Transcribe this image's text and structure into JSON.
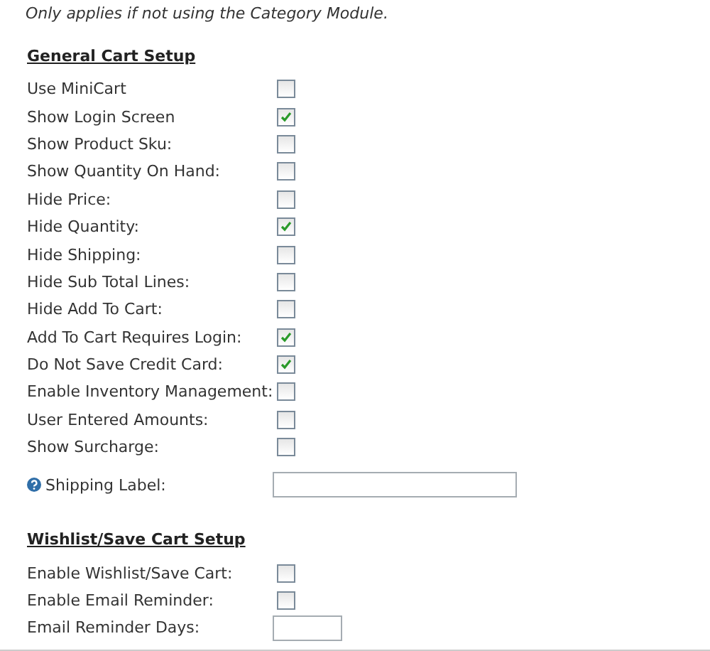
{
  "note": "Only applies if not using the Category Module.",
  "sections": [
    {
      "heading": "General Cart Setup",
      "rows": [
        {
          "kind": "checkbox",
          "label": "Use MiniCart",
          "checked": false
        },
        {
          "kind": "checkbox",
          "label": "Show Login Screen",
          "checked": true
        },
        {
          "kind": "checkbox",
          "label": "Show Product Sku:",
          "checked": false
        },
        {
          "kind": "checkbox",
          "label": "Show Quantity On Hand:",
          "checked": false
        },
        {
          "kind": "checkbox",
          "label": "Hide Price:",
          "checked": false
        },
        {
          "kind": "checkbox",
          "label": "Hide Quantity:",
          "checked": true
        },
        {
          "kind": "checkbox",
          "label": "Hide Shipping:",
          "checked": false
        },
        {
          "kind": "checkbox",
          "label": "Hide Sub Total Lines:",
          "checked": false
        },
        {
          "kind": "checkbox",
          "label": "Hide Add To Cart:",
          "checked": false
        },
        {
          "kind": "checkbox",
          "label": "Add To Cart Requires Login:",
          "checked": true
        },
        {
          "kind": "checkbox",
          "label": "Do Not Save Credit Card:",
          "checked": true
        },
        {
          "kind": "checkbox",
          "label": "Enable Inventory Management:",
          "checked": false
        },
        {
          "kind": "checkbox",
          "label": "User Entered Amounts:",
          "checked": false
        },
        {
          "kind": "checkbox",
          "label": "Show Surcharge:",
          "checked": false
        },
        {
          "kind": "wide_field",
          "label": "Shipping Label:",
          "help": true
        }
      ]
    },
    {
      "heading": "Wishlist/Save Cart Setup",
      "rows": [
        {
          "kind": "checkbox",
          "label": "Enable Wishlist/Save Cart:",
          "checked": false
        },
        {
          "kind": "checkbox",
          "label": "Enable Email Reminder:",
          "checked": false
        },
        {
          "kind": "short_field",
          "label": "Email Reminder Days:"
        }
      ]
    }
  ]
}
